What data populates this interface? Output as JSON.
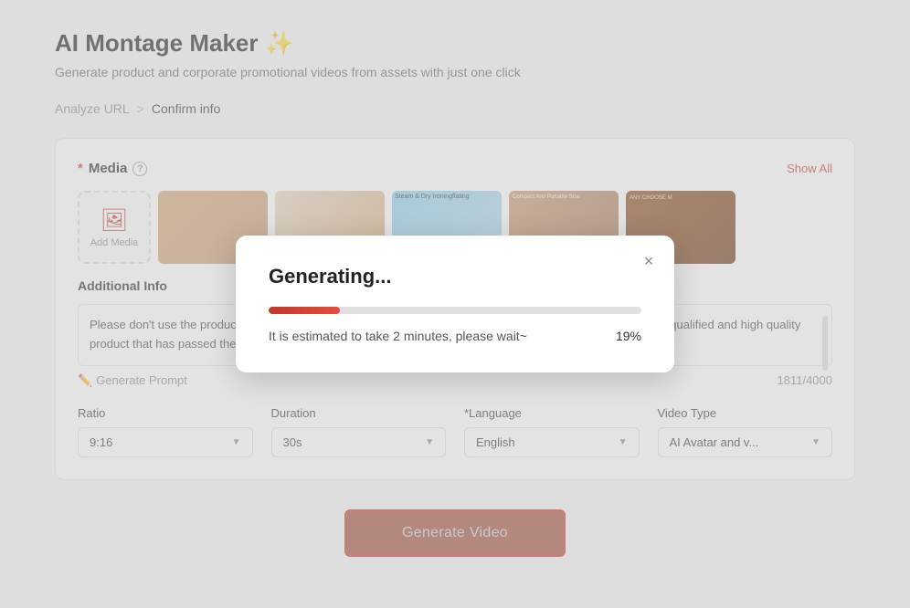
{
  "page": {
    "title": "AI Montage Maker ✨",
    "subtitle": "Generate product and corporate promotional videos from assets with just one click"
  },
  "breadcrumb": {
    "step1": "Analyze URL",
    "separator": ">",
    "step2": "Confirm info"
  },
  "media_section": {
    "label": "Media",
    "show_all": "Show All",
    "add_media_label": "Add Media"
  },
  "additional_info": {
    "label": "Additional Info",
    "text": "Please don't use the product without reading the instructions received. This indicates that you have received a qualified and high quality product that has passed the water tank test! Please feel free to use it. › See more product details, and",
    "char_count": "1811/4000"
  },
  "generate_prompt": {
    "label": "Generate Prompt"
  },
  "form": {
    "ratio": {
      "label": "Ratio",
      "value": "9:16"
    },
    "duration": {
      "label": "Duration",
      "value": "30s"
    },
    "language": {
      "label": "*Language",
      "value": "English"
    },
    "video_type": {
      "label": "Video Type",
      "value": "AI Avatar and v..."
    }
  },
  "generate_button": {
    "label": "Generate Video"
  },
  "modal": {
    "title": "Generating...",
    "status_text": "It is estimated to take 2 minutes, please wait~",
    "progress": 19,
    "progress_label": "19%",
    "close_icon": "×"
  }
}
